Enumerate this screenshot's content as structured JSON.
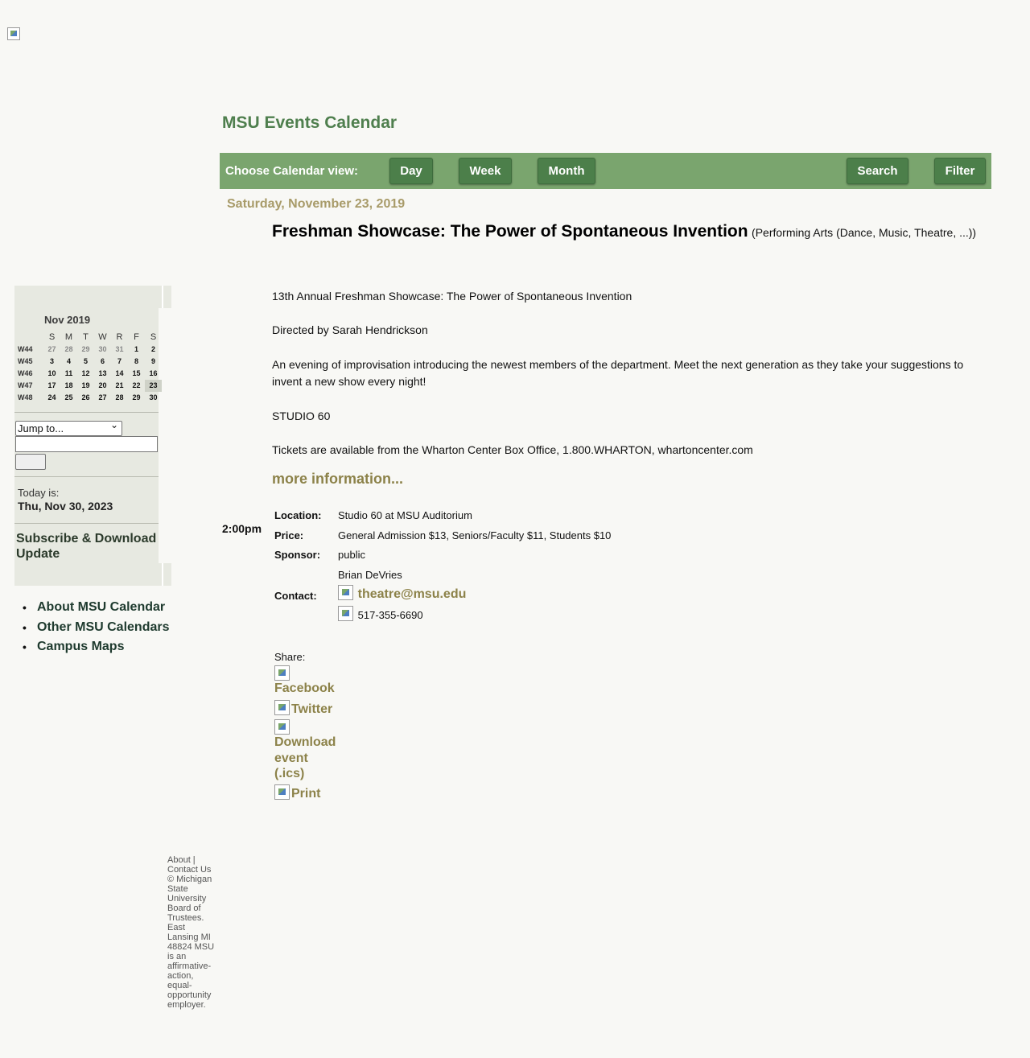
{
  "site_title": "MSU Events Calendar",
  "toolbar": {
    "label": "Choose Calendar view:",
    "day": "Day",
    "week": "Week",
    "month": "Month",
    "search": "Search",
    "filter": "Filter"
  },
  "date_heading": "Saturday, November 23, 2019",
  "event": {
    "title": "Freshman Showcase: The Power of Spontaneous Invention",
    "category": "(Performing Arts (Dance, Music, Theatre, ...))",
    "paragraphs": [
      "13th Annual Freshman Showcase: The Power of Spontaneous Invention",
      "Directed by Sarah Hendrickson",
      "An evening of improvisation introducing the newest members of the department. Meet the next generation as they take your suggestions to invent a new show every night!",
      "STUDIO 60",
      "Tickets are available from the Wharton Center Box Office, 1.800.WHARTON, whartoncenter.com"
    ],
    "more_info": "more information...",
    "time": "2:00pm",
    "location_label": "Location:",
    "location": "Studio 60 at MSU Auditorium",
    "price_label": "Price:",
    "price": "General Admission $13, Seniors/Faculty $11, Students $10",
    "sponsor_label": "Sponsor:",
    "sponsor": "public",
    "contact_label": "Contact:",
    "contact_name": "Brian DeVries",
    "contact_email": "theatre@msu.edu",
    "contact_phone": "517-355-6690"
  },
  "share": {
    "label": "Share:",
    "facebook": "Facebook",
    "twitter": "Twitter",
    "download": "Download event (.ics)",
    "print": "Print"
  },
  "mini_calendar": {
    "month": "Nov 2019",
    "day_headers": [
      "S",
      "M",
      "T",
      "W",
      "R",
      "F",
      "S"
    ],
    "weeks": [
      {
        "week": "W44",
        "days": [
          "27",
          "28",
          "29",
          "30",
          "31",
          "1",
          "2"
        ]
      },
      {
        "week": "W45",
        "days": [
          "3",
          "4",
          "5",
          "6",
          "7",
          "8",
          "9"
        ]
      },
      {
        "week": "W46",
        "days": [
          "10",
          "11",
          "12",
          "13",
          "14",
          "15",
          "16"
        ]
      },
      {
        "week": "W47",
        "days": [
          "17",
          "18",
          "19",
          "20",
          "21",
          "22",
          "23"
        ]
      },
      {
        "week": "W48",
        "days": [
          "24",
          "25",
          "26",
          "27",
          "28",
          "29",
          "30"
        ]
      }
    ]
  },
  "jump": {
    "select_value": "Jump to..."
  },
  "today": {
    "label": "Today is:",
    "value": "Thu, Nov 30, 2023"
  },
  "subscribe": "Subscribe & Download Update",
  "side_links": [
    "About MSU Calendar",
    "Other MSU Calendars",
    "Campus Maps"
  ],
  "footer": "About | Contact Us © Michigan State University Board of Trustees. East Lansing MI 48824 MSU is an affirmative-action, equal-opportunity employer."
}
